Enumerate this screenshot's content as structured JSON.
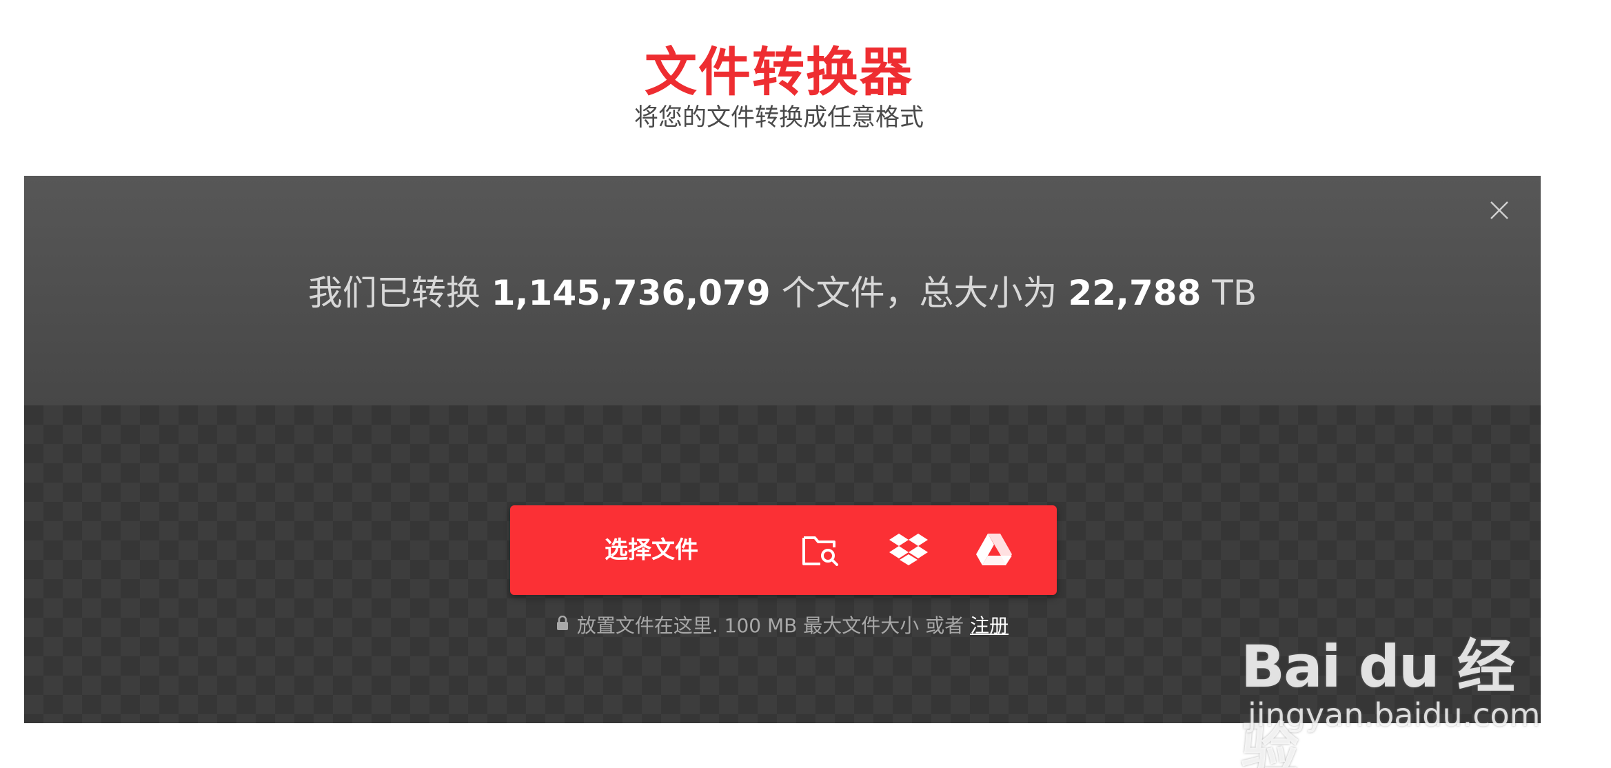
{
  "header": {
    "title": "文件转换器",
    "subtitle": "将您的文件转换成任意格式"
  },
  "stats": {
    "prefix": "我们已转换 ",
    "files_count": "1,145,736,079",
    "middle": " 个文件，总大小为 ",
    "total_size": "22,788",
    "unit": " TB"
  },
  "upload": {
    "choose_label": "选择文件",
    "sources": [
      "folder-search-icon",
      "dropbox-icon",
      "google-drive-icon"
    ],
    "note_text": "放置文件在这里. 100 MB 最大文件大小 或者 ",
    "signup_link": "注册"
  },
  "watermark": {
    "brand": "Bai du 经验",
    "url": "jingyan.baidu.com"
  },
  "colors": {
    "accent": "#fb3035",
    "title": "#ee2d31",
    "panel_top": "#575757",
    "panel_bottom": "#363636"
  }
}
